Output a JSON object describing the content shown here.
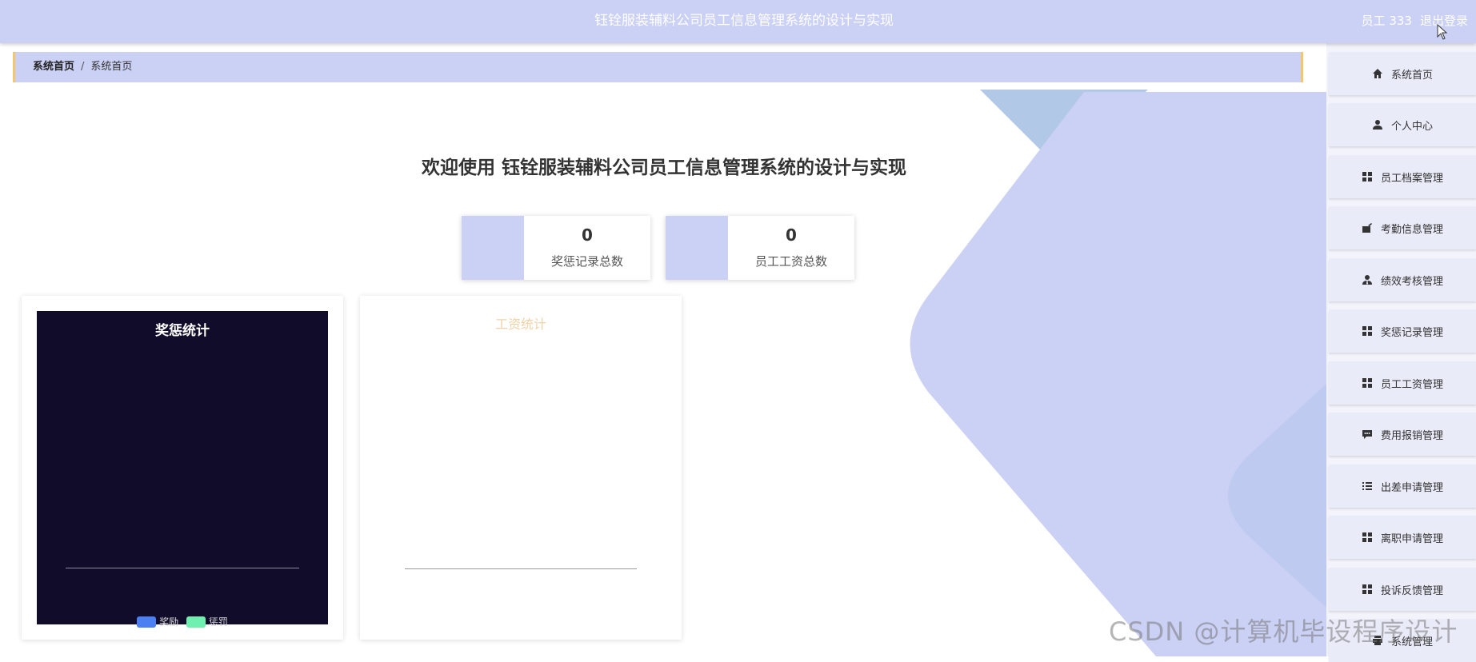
{
  "header": {
    "title": "钰铨服装辅料公司员工信息管理系统的设计与实现",
    "user_label": "员工 333",
    "logout_label": "退出登录"
  },
  "breadcrumb": {
    "items": [
      "系统首页",
      "系统首页"
    ],
    "separator": "/"
  },
  "welcome": {
    "text": "欢迎使用 钰铨服装辅料公司员工信息管理系统的设计与实现"
  },
  "stats": [
    {
      "value": "0",
      "label": "奖惩记录总数"
    },
    {
      "value": "0",
      "label": "员工工资总数"
    }
  ],
  "charts": {
    "reward": {
      "title": "奖惩统计",
      "legend": [
        {
          "name": "奖励",
          "color": "#4b7ff2"
        },
        {
          "name": "惩罚",
          "color": "#6ff0b0"
        }
      ]
    },
    "salary": {
      "title": "工资统计"
    }
  },
  "chart_data": [
    {
      "type": "bar",
      "title": "奖惩统计",
      "categories": [],
      "series": [
        {
          "name": "奖励",
          "values": []
        },
        {
          "name": "惩罚",
          "values": []
        }
      ],
      "legend_position": "bottom"
    },
    {
      "type": "bar",
      "title": "工资统计",
      "categories": [],
      "series": []
    }
  ],
  "sidebar": {
    "items": [
      {
        "label": "系统首页",
        "icon": "home-icon"
      },
      {
        "label": "个人中心",
        "icon": "user-icon"
      },
      {
        "label": "员工档案管理",
        "icon": "grid-icon"
      },
      {
        "label": "考勤信息管理",
        "icon": "briefcase-icon"
      },
      {
        "label": "绩效考核管理",
        "icon": "user-tie-icon"
      },
      {
        "label": "奖惩记录管理",
        "icon": "grid-icon"
      },
      {
        "label": "员工工资管理",
        "icon": "grid-icon"
      },
      {
        "label": "费用报销管理",
        "icon": "comment-icon"
      },
      {
        "label": "出差申请管理",
        "icon": "list-icon"
      },
      {
        "label": "离职申请管理",
        "icon": "grid-icon"
      },
      {
        "label": "投诉反馈管理",
        "icon": "grid-icon"
      },
      {
        "label": "系统管理",
        "icon": "printer-icon"
      }
    ]
  },
  "watermark": "CSDN @计算机毕设程序设计",
  "colors": {
    "accent": "#cbd0f5",
    "breadcrumb_border": "#f5c76b",
    "chart_dark_bg": "#120c2b",
    "salary_title": "#f0d2a8"
  }
}
